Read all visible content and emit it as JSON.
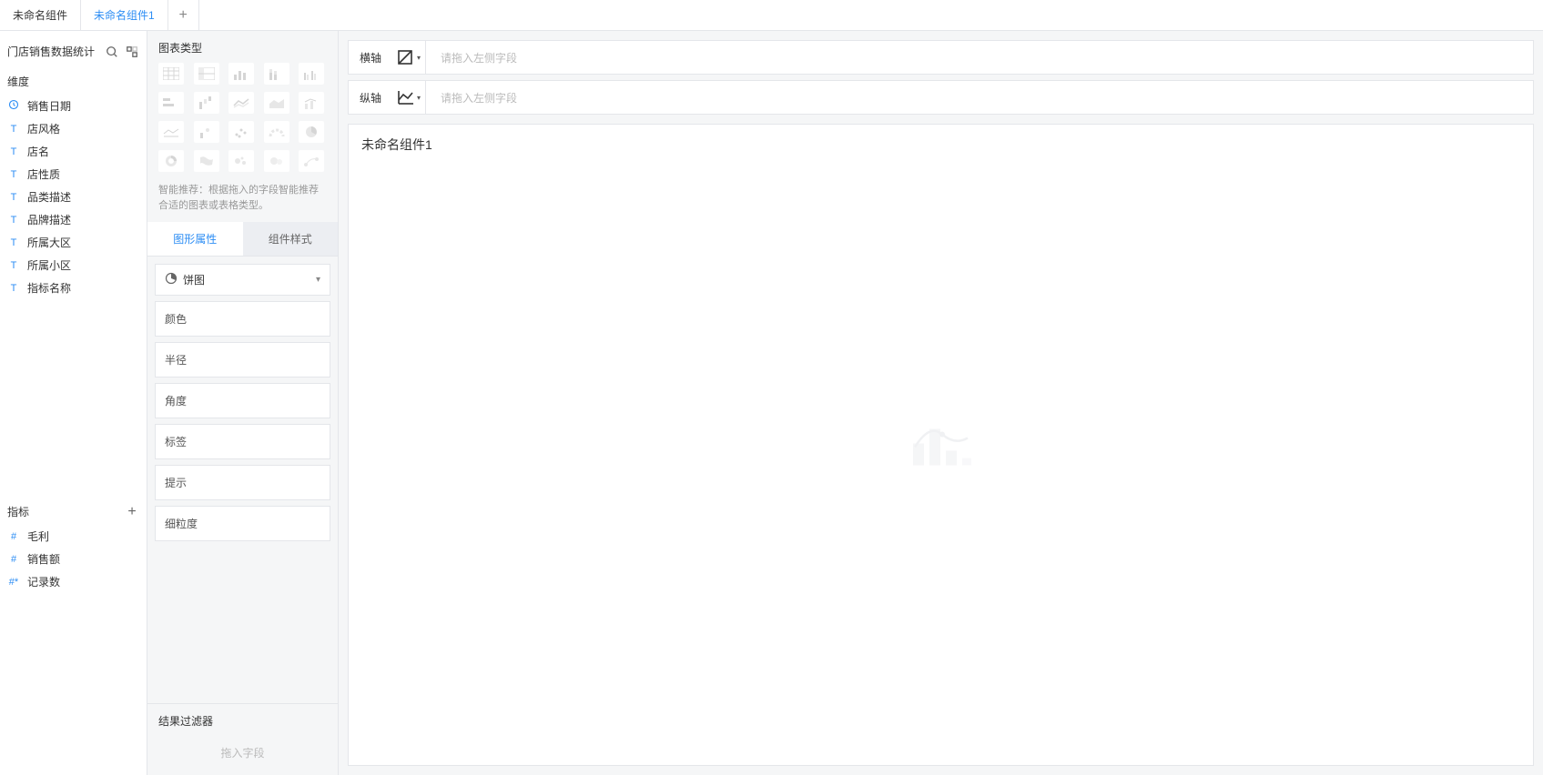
{
  "tabs": {
    "list": [
      {
        "label": "未命名组件"
      },
      {
        "label": "未命名组件1"
      }
    ],
    "active_index": 1
  },
  "data_source": {
    "title": "门店销售数据统计"
  },
  "dimensions": {
    "title": "维度",
    "items": [
      {
        "type": "clock",
        "label": "销售日期"
      },
      {
        "type": "T",
        "label": "店风格"
      },
      {
        "type": "T",
        "label": "店名"
      },
      {
        "type": "T",
        "label": "店性质"
      },
      {
        "type": "T",
        "label": "品类描述"
      },
      {
        "type": "T",
        "label": "品牌描述"
      },
      {
        "type": "T",
        "label": "所属大区"
      },
      {
        "type": "T",
        "label": "所属小区"
      },
      {
        "type": "T",
        "label": "指标名称"
      }
    ]
  },
  "measures": {
    "title": "指标",
    "items": [
      {
        "type": "#",
        "label": "毛利"
      },
      {
        "type": "#",
        "label": "销售额"
      },
      {
        "type": "#*",
        "label": "记录数"
      }
    ]
  },
  "chart_config": {
    "chart_type_title": "图表类型",
    "hint": "智能推荐：根据拖入的字段智能推荐合适的图表或表格类型。",
    "inner_tabs": {
      "graphic_attr": "图形属性",
      "component_style": "组件样式"
    },
    "selector_label": "饼图",
    "attrs": [
      {
        "label": "颜色"
      },
      {
        "label": "半径"
      },
      {
        "label": "角度"
      },
      {
        "label": "标签"
      },
      {
        "label": "提示"
      },
      {
        "label": "细粒度"
      }
    ],
    "filter": {
      "title": "结果过滤器",
      "placeholder": "拖入字段"
    }
  },
  "canvas": {
    "h_axis_label": "横轴",
    "v_axis_label": "纵轴",
    "axis_placeholder": "请拖入左侧字段",
    "component_title": "未命名组件1"
  }
}
